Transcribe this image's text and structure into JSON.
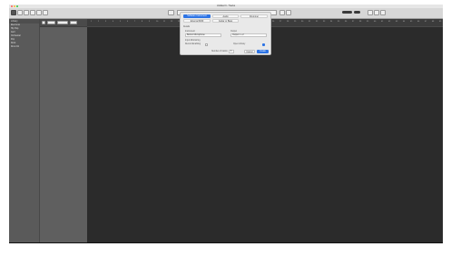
{
  "window": {
    "title": "Untitled 3 - Tracks"
  },
  "toolbar": {
    "buttons": [
      "library-button",
      "inspector-button",
      "toolbar-button",
      "smart-controls-button",
      "mixer-button",
      "editors-button"
    ],
    "display": {
      "label": "LCD display"
    }
  },
  "sidebar": {
    "header": "Library",
    "items": [
      "Electronic",
      "Hip Hop",
      "Jazz",
      "Orchestral",
      "Pop",
      "Rock",
      "Drum Kit"
    ]
  },
  "tracks_header": {
    "buttons": [
      "add-track",
      "edit",
      "functions",
      "view"
    ]
  },
  "ruler": {
    "ticks": [
      "1",
      "2",
      "3",
      "4",
      "5",
      "6",
      "7",
      "8",
      "9",
      "10",
      "11",
      "12",
      "13",
      "14",
      "15",
      "16",
      "17",
      "18",
      "19",
      "20",
      "21",
      "22",
      "23",
      "24",
      "25",
      "26",
      "27",
      "28",
      "29",
      "30",
      "31",
      "32",
      "33",
      "34",
      "35",
      "36",
      "37",
      "38",
      "39",
      "40",
      "41",
      "42",
      "43",
      "44",
      "45",
      "46",
      "47",
      "48",
      "49"
    ]
  },
  "dialog": {
    "tabs_row1": [
      "Software Instrument",
      "Audio",
      "Drummer"
    ],
    "tabs_row2": [
      "External MIDI",
      "Guitar or Bass"
    ],
    "section_label": "Details",
    "instrument_label": "Instrument",
    "instrument_value": "Built-in Microphone",
    "output_label": "Output",
    "output_value": "Output 1 + 2",
    "input_monitoring_label": "Input Monitoring",
    "record_enable_label": "Record Enabling",
    "open_library_label": "Open Library",
    "count_label": "Number of tracks:",
    "count_value": "1",
    "cancel_label": "Cancel",
    "create_label": "Create"
  },
  "colors": {
    "accent": "#2d74e5",
    "workspace": "#2b2b2b",
    "sidebar": "#5a5a5a"
  }
}
